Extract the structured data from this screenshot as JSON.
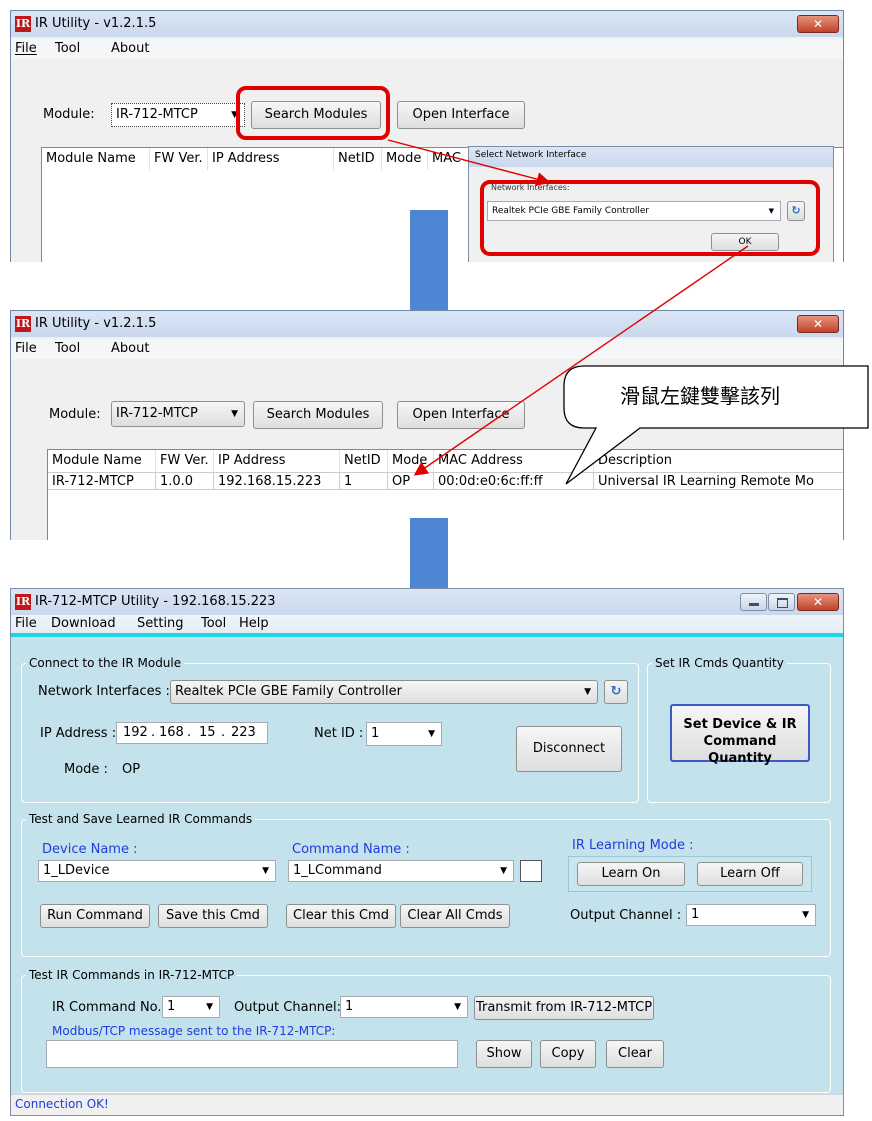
{
  "panel1": {
    "title": "IR Utility - v1.2.1.5",
    "close": "✕",
    "menu": [
      "File",
      "Tool",
      "About"
    ],
    "module_label": "Module:",
    "module_value": "IR-712-MTCP",
    "search_button": "Search Modules",
    "open_button": "Open Interface",
    "columns": [
      "Module Name",
      "FW Ver.",
      "IP Address",
      "NetID",
      "Mode",
      "MAC"
    ]
  },
  "dialog": {
    "title": "Select Network Interface",
    "label": "Network Interfaces:",
    "value": "Realtek PCIe GBE Family Controller",
    "ok": "OK"
  },
  "panel2": {
    "title": "IR Utility - v1.2.1.5",
    "close": "✕",
    "menu": [
      "File",
      "Tool",
      "About"
    ],
    "module_label": "Module:",
    "module_value": "IR-712-MTCP",
    "search_button": "Search Modules",
    "open_button": "Open Interface",
    "columns": [
      "Module Name",
      "FW Ver.",
      "IP Address",
      "NetID",
      "Mode",
      "MAC Address",
      "Description"
    ],
    "row": [
      "IR-712-MTCP",
      "1.0.0",
      "192.168.15.223",
      "1",
      "OP",
      "00:0d:e0:6c:ff:ff",
      "Universal IR Learning Remote Mo"
    ]
  },
  "callout": "滑鼠左鍵雙擊該列",
  "panel3": {
    "title": "IR-712-MTCP Utility - 192.168.15.223",
    "menu": [
      "File",
      "Download",
      "Setting",
      "Tool",
      "Help"
    ],
    "connect_group": "Connect to the IR Module",
    "net_if_label": "Network Interfaces :",
    "net_if_value": "Realtek PCIe GBE Family Controller",
    "ip_label": "IP Address :",
    "ip": [
      "192",
      "168",
      "15",
      "223"
    ],
    "netid_label": "Net ID :",
    "netid_value": "1",
    "disconnect": "Disconnect",
    "mode_label": "Mode :",
    "mode_value": "OP",
    "qty_group": "Set IR Cmds Quantity",
    "qty_button_line1": "Set Device & IR",
    "qty_button_line2": "Command Quantity",
    "test_group": "Test and Save Learned IR Commands",
    "device_label": "Device Name :",
    "device_value": "1_LDevice",
    "command_label": "Command Name :",
    "command_value": "1_LCommand",
    "learning_label": "IR Learning Mode :",
    "learn_on": "Learn On",
    "learn_off": "Learn Off",
    "run_cmd": "Run Command",
    "save_cmd": "Save this Cmd",
    "clear_cmd": "Clear this Cmd",
    "clear_all": "Clear All Cmds",
    "out_ch_label": "Output Channel :",
    "out_ch_value": "1",
    "test2_group": "Test IR Commands in IR-712-MTCP",
    "ir_no_label": "IR Command No.:",
    "ir_no_value": "1",
    "out_ch2_label": "Output Channel:",
    "out_ch2_value": "1",
    "transmit": "Transmit from IR-712-MTCP",
    "modbus_label": "Modbus/TCP message sent to the IR-712-MTCP:",
    "modbus_value": "",
    "show": "Show",
    "copy": "Copy",
    "clear": "Clear",
    "status": "Connection OK!"
  },
  "colors": {
    "accent_red": "#e00000",
    "arrow_blue": "#4f86d4",
    "panel_bg": "#c4e2ec",
    "blue_text": "#1f3cdc"
  }
}
